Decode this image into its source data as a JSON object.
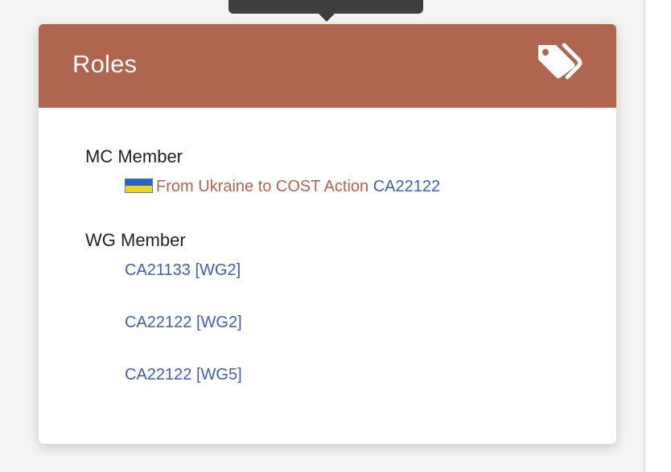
{
  "roles_card": {
    "title": "Roles",
    "header_color": "#b0654f",
    "icon": "tags-icon"
  },
  "mc_member": {
    "heading": "MC Member",
    "flag_icon": "ukraine-flag-icon",
    "action_title": "From Ukraine to COST Action",
    "action_code": "CA22122"
  },
  "wg_member": {
    "heading": "WG Member",
    "items": [
      {
        "label": "CA21133 [WG2]"
      },
      {
        "label": "CA22122 [WG2]"
      },
      {
        "label": "CA22122 [WG5]"
      }
    ]
  }
}
